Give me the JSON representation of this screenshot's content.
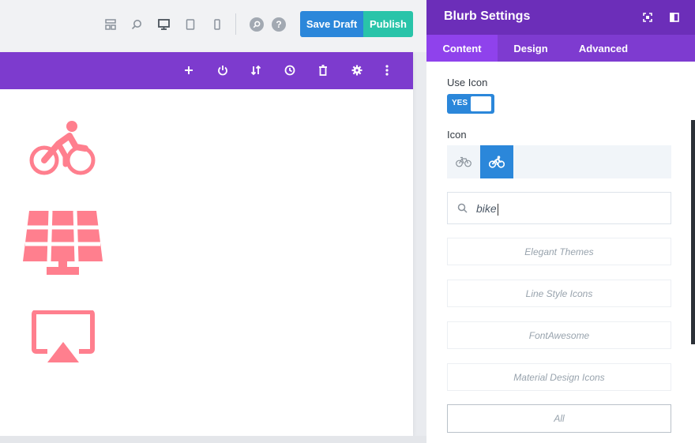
{
  "toolbar": {
    "icons": [
      "wireframe-icon",
      "zoom-icon",
      "desktop-icon",
      "tablet-icon",
      "phone-icon",
      "search-circle-icon",
      "help-icon"
    ],
    "help_label": "?",
    "save_draft_label": "Save Draft",
    "publish_label": "Publish"
  },
  "row_toolbar": {
    "icons": [
      "add-icon",
      "power-icon",
      "sort-icon",
      "history-icon",
      "trash-icon",
      "gear-icon",
      "more-icon"
    ]
  },
  "canvas": {
    "modules": [
      "bicycle-icon",
      "solar-panel-icon",
      "airplay-icon"
    ],
    "icon_color": "#ff7f8e"
  },
  "panel": {
    "title": "Blurb Settings",
    "tabs": [
      "Content",
      "Design",
      "Advanced"
    ],
    "active_tab": "Content",
    "use_icon_label": "Use Icon",
    "toggle_label": "YES",
    "icon_label": "Icon",
    "search_value": "bike",
    "filters": [
      "Elegant Themes",
      "Line Style Icons",
      "FontAwesome",
      "Material Design Icons",
      "All"
    ]
  },
  "colors": {
    "purple_header": "#6c2eb9",
    "purple_row": "#7d3bce",
    "accent_blue": "#2b87da",
    "publish_green": "#29c4a9",
    "icon_pink": "#ff7f8e"
  }
}
